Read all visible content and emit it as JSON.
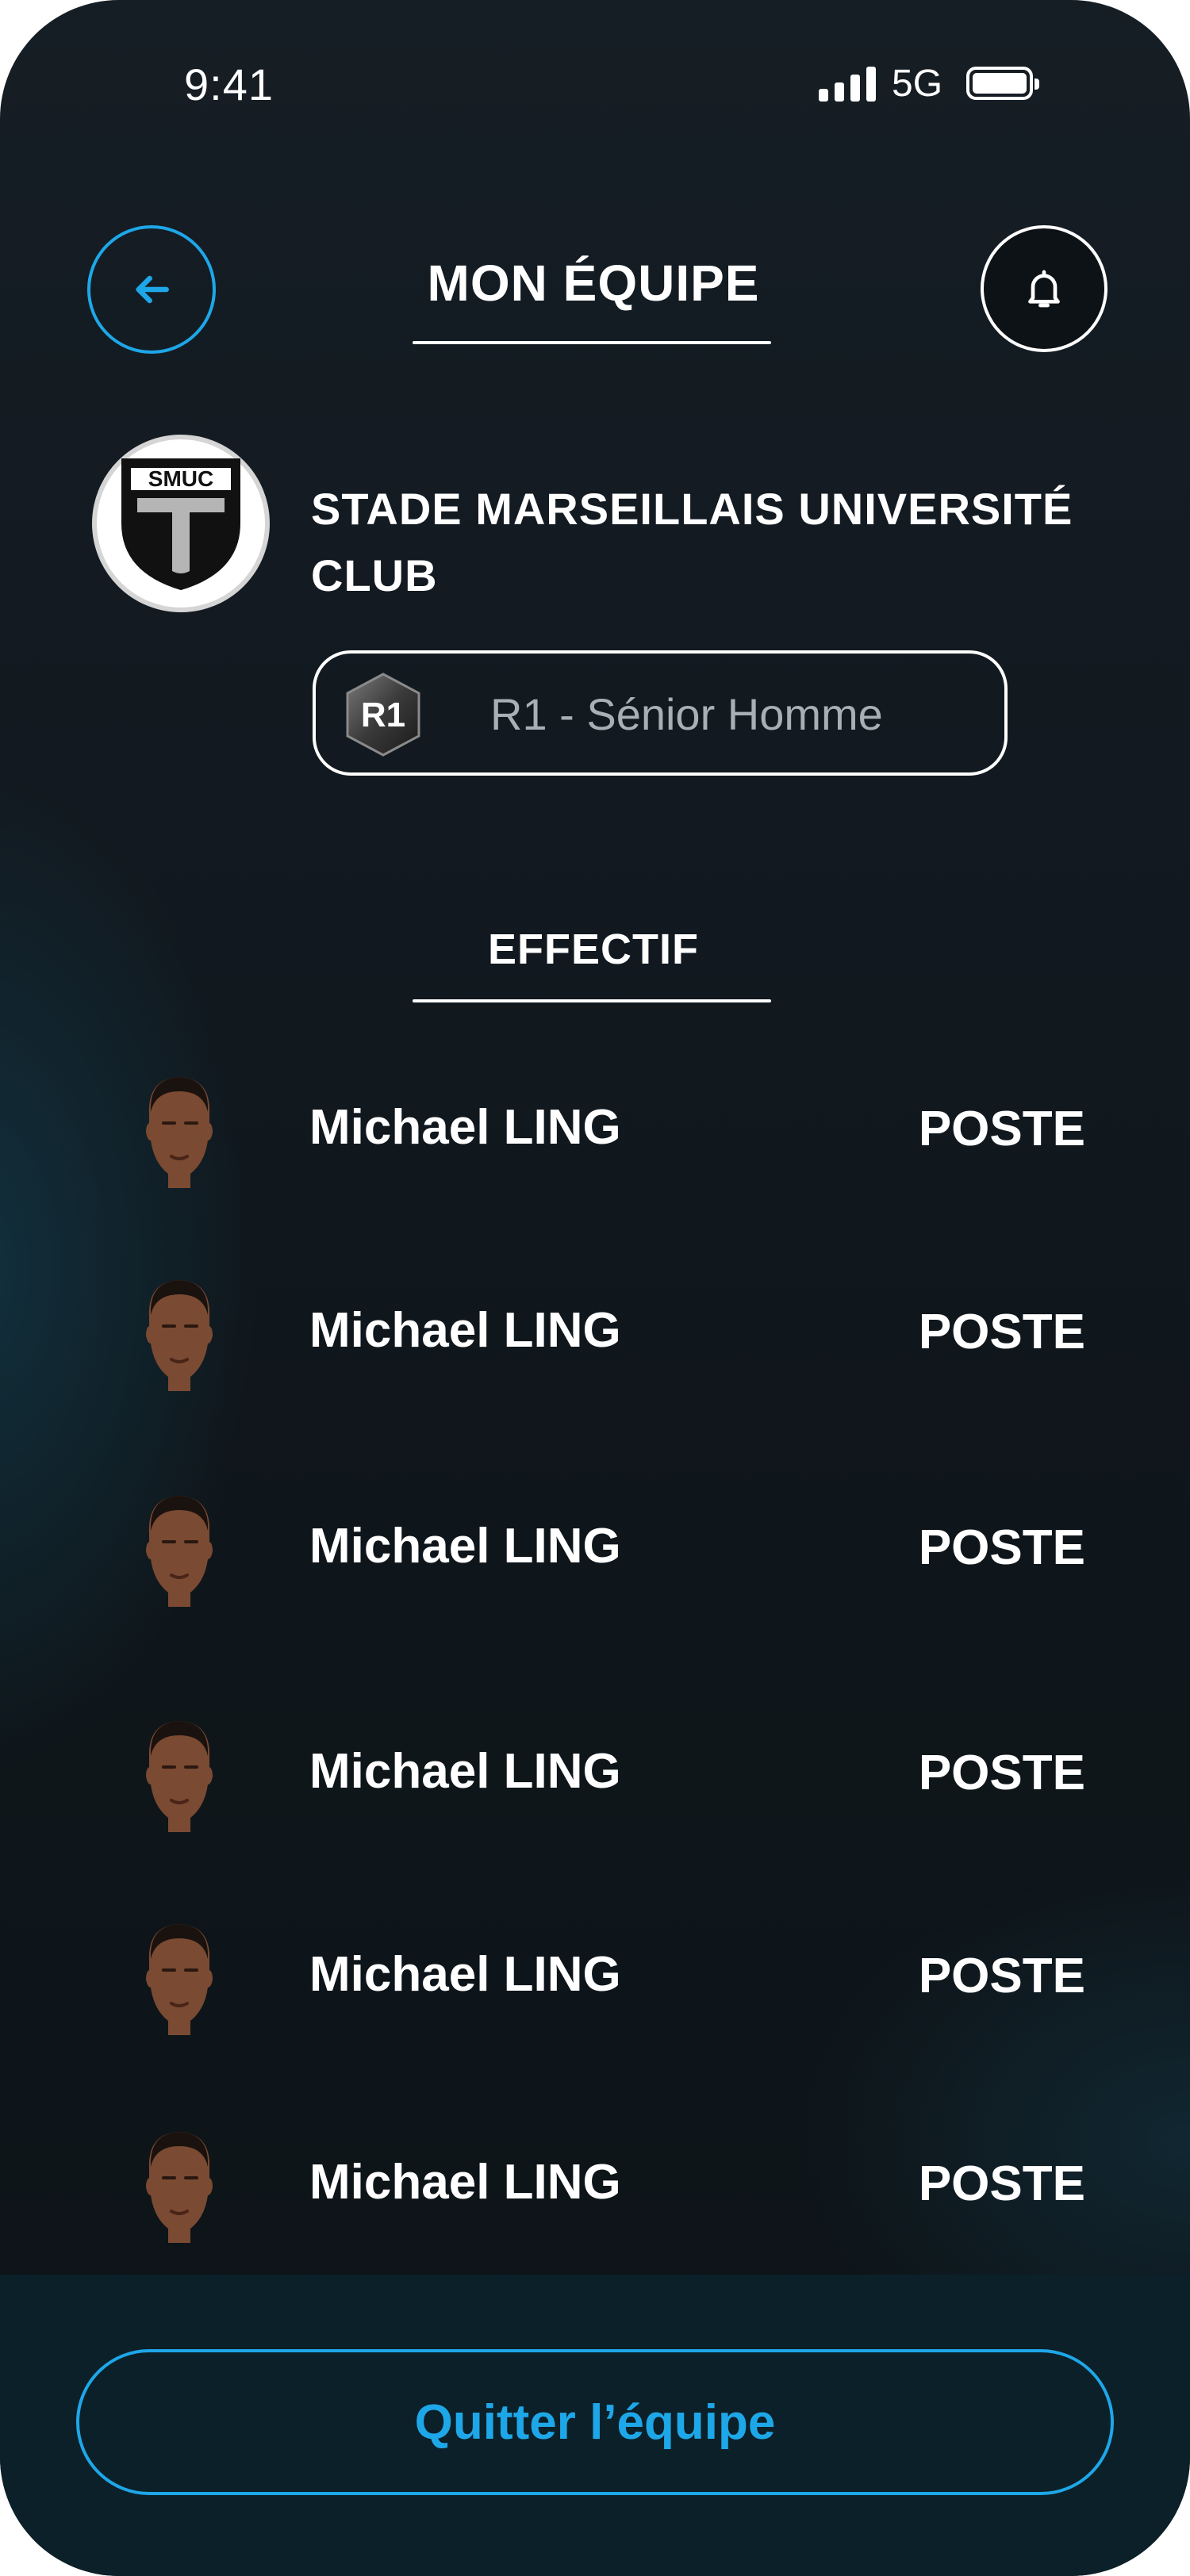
{
  "status_bar": {
    "time": "9:41",
    "network": "5G"
  },
  "header": {
    "title": "MON ÉQUIPE",
    "back_icon": "arrow-left-icon",
    "bell_icon": "bell-icon"
  },
  "club": {
    "name": "STADE MARSEILLAIS UNIVERSITÉ CLUB",
    "logo_text": "SMUC"
  },
  "league": {
    "badge": "R1",
    "label": "R1 - Sénior Homme"
  },
  "section": {
    "title": "EFFECTIF"
  },
  "players": [
    {
      "name": "Michael LING",
      "position": "POSTE"
    },
    {
      "name": "Michael LING",
      "position": "POSTE"
    },
    {
      "name": "Michael LING",
      "position": "POSTE"
    },
    {
      "name": "Michael LING",
      "position": "POSTE"
    },
    {
      "name": "Michael LING",
      "position": "POSTE"
    },
    {
      "name": "Michael LING",
      "position": "POSTE"
    }
  ],
  "actions": {
    "leave_label": "Quitter l’équipe"
  },
  "colors": {
    "accent": "#1ea7e8",
    "background": "#121920",
    "bottom_bar": "#0b2028"
  }
}
